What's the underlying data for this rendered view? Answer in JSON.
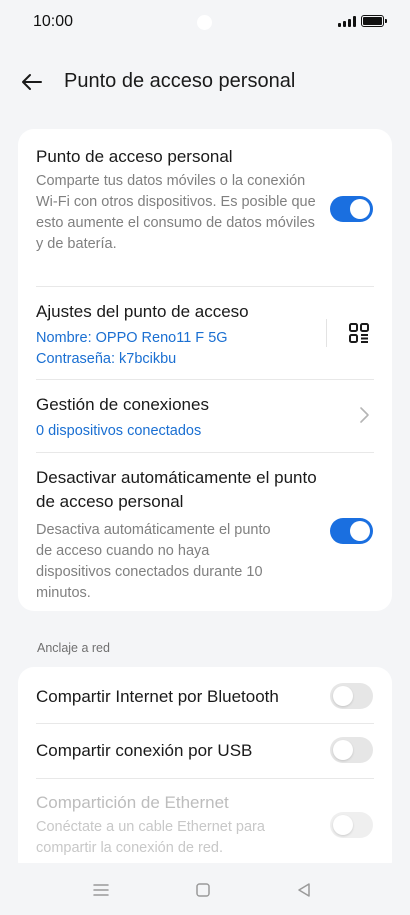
{
  "status_bar": {
    "time": "10:00"
  },
  "header": {
    "title": "Punto de acceso personal"
  },
  "hotspot": {
    "title": "Punto de acceso personal",
    "description": "Comparte tus datos móviles o la conexión Wi-Fi con otros dispositivos. Es posible que esto aumente el consumo de datos móviles y de batería.",
    "enabled": true
  },
  "settings": {
    "title": "Ajustes del punto de acceso",
    "name_line": "Nombre: OPPO Reno11 F 5G",
    "password_line": "Contraseña: k7bcikbu",
    "qr_icon": "qr-code-icon"
  },
  "connections": {
    "title": "Gestión de conexiones",
    "subtitle": "0 dispositivos conectados"
  },
  "auto_off": {
    "title": "Desactivar automáticamente el punto de acceso personal",
    "description": "Desactiva automáticamente el punto de acceso cuando no haya dispositivos conectados durante 10 minutos.",
    "enabled": true
  },
  "tethering": {
    "section_label": "Anclaje a red",
    "bluetooth": {
      "title": "Compartir Internet por Bluetooth",
      "enabled": false
    },
    "usb": {
      "title": "Compartir conexión por USB",
      "enabled": false
    },
    "ethernet": {
      "title": "Compartición de Ethernet",
      "description": "Conéctate a un cable Ethernet para compartir la conexión de red.",
      "enabled": false,
      "disabled": true
    }
  },
  "colors": {
    "accent": "#1a6fe0",
    "link": "#1a6fd2",
    "background": "#f4f5f7"
  },
  "nav": {
    "icons": [
      "menu-icon",
      "home-icon",
      "back-triangle-icon"
    ]
  }
}
